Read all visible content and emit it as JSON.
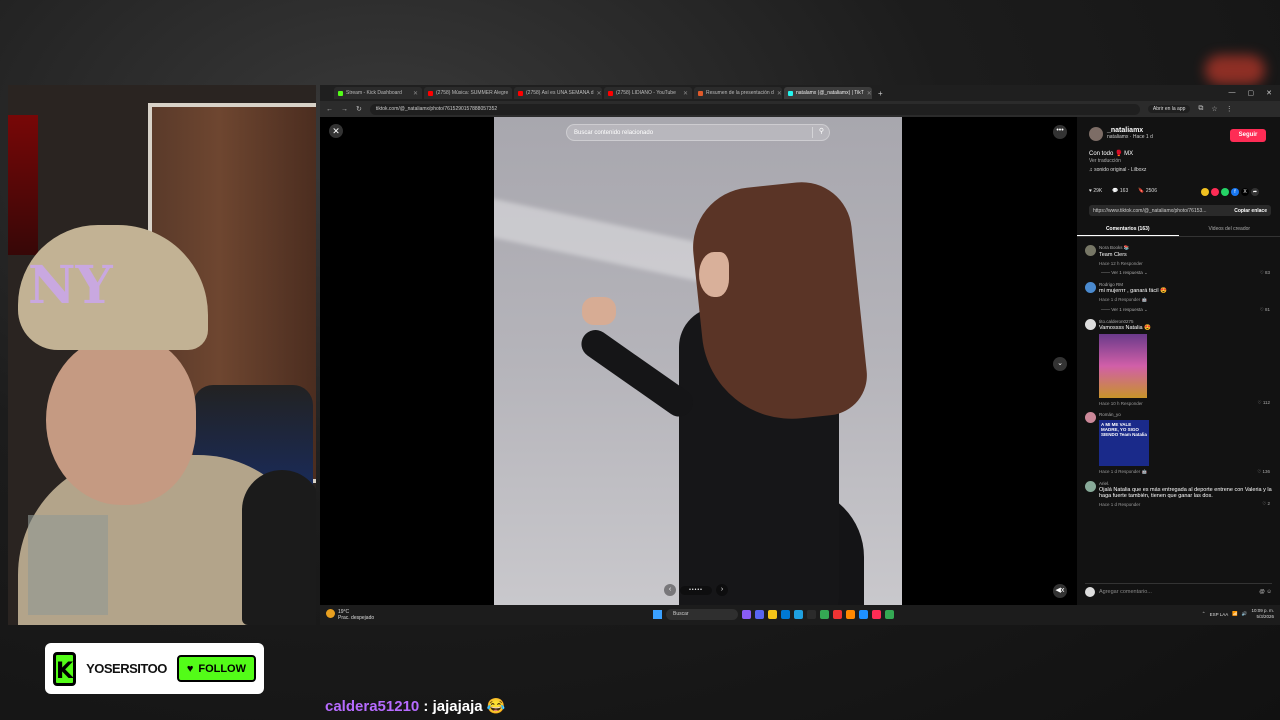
{
  "browser": {
    "tabs": [
      {
        "label": "Stream - Kick Dashboard",
        "color": "#53fc18"
      },
      {
        "label": "(2758) Música: SUMMER Alegre",
        "color": "#ff0000"
      },
      {
        "label": "(2758) Así es UNA SEMANA d",
        "color": "#ff0000"
      },
      {
        "label": "(2758) LIDIANO - YouTube",
        "color": "#ff0000"
      },
      {
        "label": "Resumen de la presentación d",
        "color": "#e05a2a"
      },
      {
        "label": "natalamx (@_nataliamx) | TikT",
        "color": "#25f4ee",
        "active": true
      }
    ],
    "url": "tiktok.com/@_nataliamx/photo/7615290157888057352",
    "open_in_app": "Abrir en la app"
  },
  "viewer": {
    "search_placeholder": "Buscar contenido relacionado",
    "carousel_dots": "•••••"
  },
  "panel": {
    "username": "_nataliamx",
    "subline": "nataliamx · Hace 1 d",
    "follow_label": "Seguir",
    "caption": "Con todo 🥊 MX",
    "translate": "Ver traducción",
    "sound": "♫ sonido original - Lilboxz",
    "stats": {
      "likes": "29K",
      "comments": "163",
      "saves": "2506"
    },
    "link": "https://www.tiktok.com/@_nataliamx/photo/76153...",
    "copy_link": "Copiar enlace",
    "tab_comments": "Comentarios (163)",
    "tab_videos": "Videos del creador",
    "comments": [
      {
        "name": "Nora Books 📚",
        "text": "Team Clers",
        "meta": "Hace 12 h   Responder",
        "likes": "♡ 83",
        "replies": "—— Ver 1 respuesta ⌄"
      },
      {
        "name": "Rodrigo RM",
        "text": "mi mujerrrr , ganará fácil 😍",
        "meta": "Hace 1 d   Responder  🤖",
        "likes": "♡ 81",
        "replies": "—— Ver 1 respuesta ⌄"
      },
      {
        "name": "tito.calderon0275",
        "text": "Vamossss Natalia 😍",
        "meta": "Hace 10 h   Responder",
        "likes": "♡ 112"
      },
      {
        "name": "Román_yo",
        "text": "",
        "meta": "Hace 1 d   Responder  🤖",
        "likes": "♡ 136",
        "img_text": "A MI ME VALE MADRE, YO SIGO SIENDO Team Natalia"
      },
      {
        "name": "Ariel.",
        "text": "Ojalá Natalia que es más entregada al deporte entrene con Valeria y la haga fuerte también, tienen que ganar las dos.",
        "meta": "Hace 1 d   Responder",
        "likes": "♡ 2"
      }
    ],
    "add_comment": "Agregar comentario..."
  },
  "taskbar": {
    "temp": "19°C",
    "weather": "Prac. despejado",
    "search": "Buscar",
    "lang": "ESP LAA",
    "time": "10:09 p. m.",
    "date": "5/3/2026"
  },
  "badge": {
    "channel": "YOSERSITOO",
    "follow": "FOLLOW"
  },
  "chat": {
    "user": "caldera51210",
    "message": "jajajaja 😂"
  },
  "colors": {
    "kick_green": "#53fc18",
    "tiktok_red": "#fe2c55"
  }
}
